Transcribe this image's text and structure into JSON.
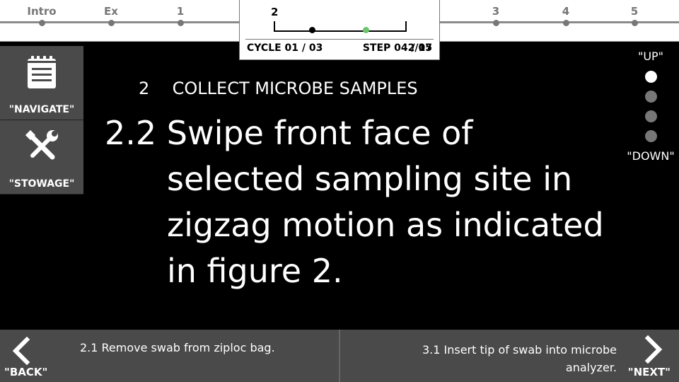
{
  "progress": {
    "stages": [
      "Intro",
      "Ex",
      "1",
      "2",
      "3",
      "4",
      "5"
    ],
    "current_stage": "2",
    "cycle_label": "CYCLE 01 / 03",
    "step_label": "STEP 04 / 07",
    "step_overlap_label": "2/15"
  },
  "sidebar": {
    "navigate_label": "\"NAVIGATE\"",
    "stowage_label": "\"STOWAGE\""
  },
  "main": {
    "section_number": "2",
    "section_title": "COLLECT MICROBE SAMPLES",
    "step_lead": "2.2 Swipe front face of",
    "step_rest": "selected sampling site in zigzag motion as indicated in figure 2."
  },
  "pager": {
    "up_label": "\"UP\"",
    "down_label": "\"DOWN\"",
    "pages": 4,
    "active_page": 1
  },
  "bottom": {
    "back_label": "\"BACK\"",
    "next_label": "\"NEXT\"",
    "previous_step": "2.1 Remove swab from ziploc bag.",
    "next_step": "3.1 Insert tip of swab into microbe analyzer."
  },
  "colors": {
    "completed_dot": "#000000",
    "current_dot": "#6cc56c",
    "inactive": "#777777"
  }
}
